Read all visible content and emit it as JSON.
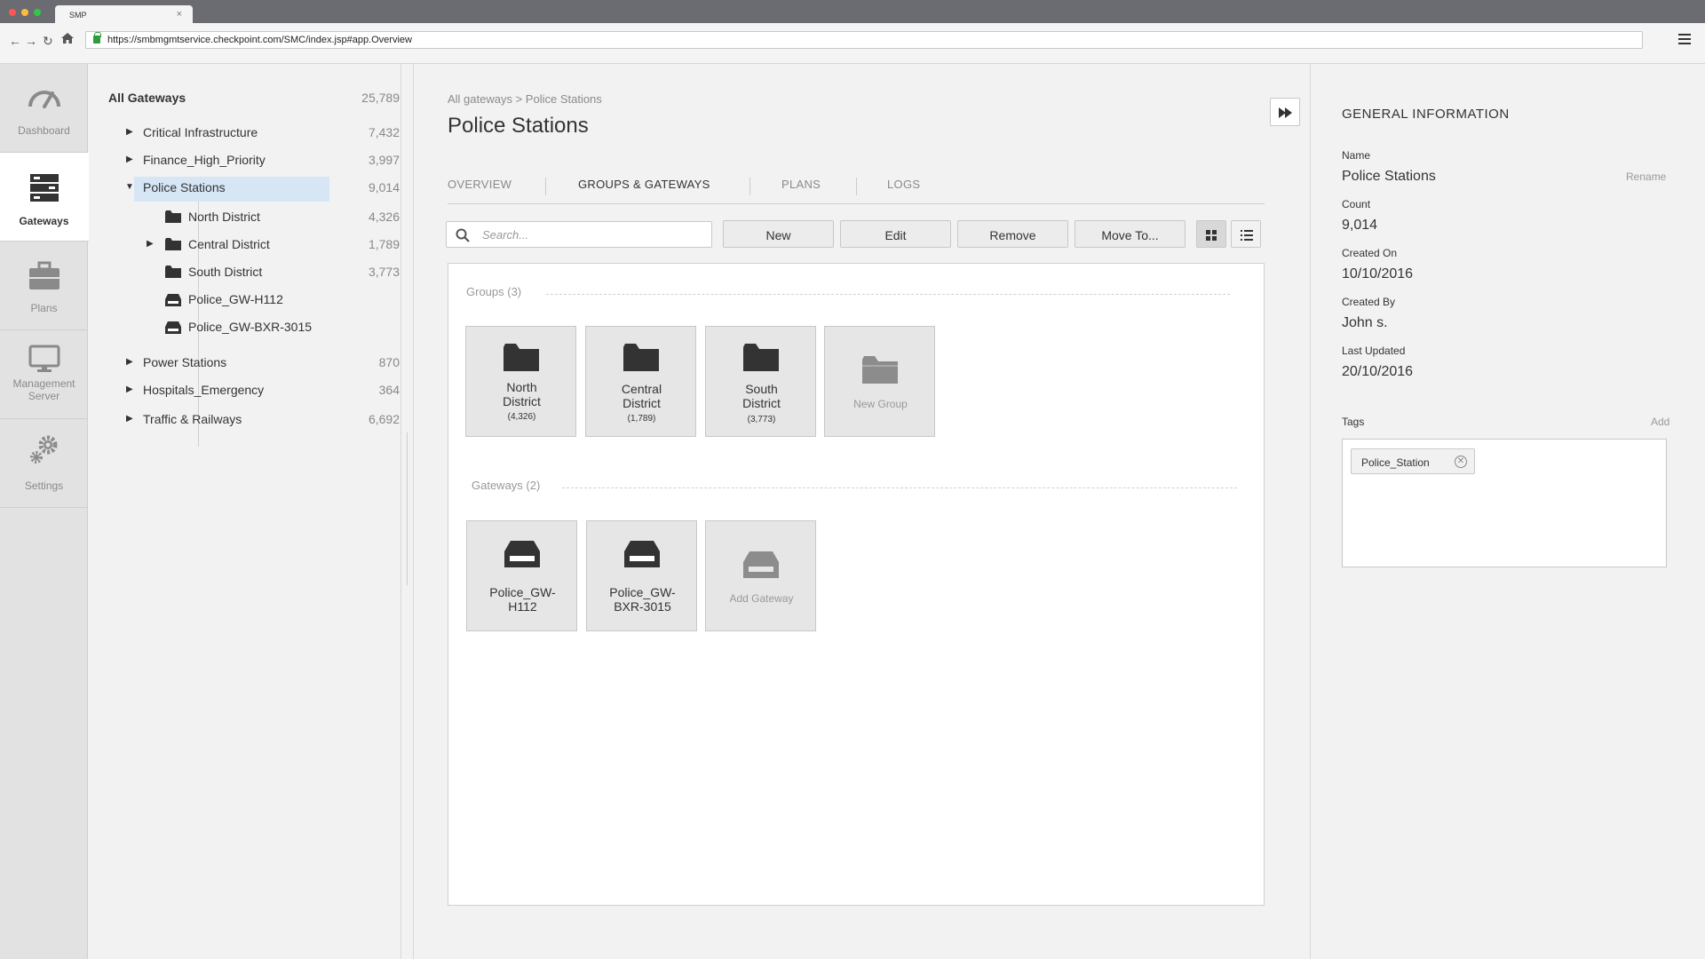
{
  "browser": {
    "tab_title": "SMP",
    "tab_close": "×",
    "url": "https://smbmgmtservice.checkpoint.com/SMC/index.jsp#app.Overview"
  },
  "rail": {
    "items": [
      {
        "label": "Dashboard",
        "icon": "gauge-icon"
      },
      {
        "label": "Gateways",
        "icon": "server-icon"
      },
      {
        "label": "Plans",
        "icon": "briefcase-icon"
      },
      {
        "label": "Management Server",
        "icon": "monitor-icon"
      },
      {
        "label": "Settings",
        "icon": "gears-icon"
      }
    ]
  },
  "tree": {
    "root": {
      "label": "All Gateways",
      "count": "25,789"
    },
    "items": [
      {
        "label": "Critical Infrastructure",
        "count": "7,432"
      },
      {
        "label": "Finance_High_Priority",
        "count": "3,997"
      },
      {
        "label": "Police Stations",
        "count": "9,014"
      },
      {
        "label": "North District",
        "count": "4,326"
      },
      {
        "label": "Central District",
        "count": "1,789"
      },
      {
        "label": "South District",
        "count": "3,773"
      },
      {
        "label": "Police_GW-H112",
        "count": ""
      },
      {
        "label": "Police_GW-BXR-3015",
        "count": ""
      },
      {
        "label": "Power Stations",
        "count": "870"
      },
      {
        "label": "Hospitals_Emergency",
        "count": "364"
      },
      {
        "label": "Traffic & Railways",
        "count": "6,692"
      }
    ]
  },
  "main": {
    "breadcrumb": "All gateways > Police Stations",
    "title": "Police Stations",
    "tabs": [
      "OVERVIEW",
      "GROUPS & GATEWAYS",
      "PLANS",
      "LOGS"
    ],
    "search_placeholder": "Search...",
    "buttons": {
      "new": "New",
      "edit": "Edit",
      "remove": "Remove",
      "move": "Move To..."
    },
    "groups_title": "Groups (3)",
    "groups": [
      {
        "line1": "North",
        "line2": "District",
        "count": "(4,326)"
      },
      {
        "line1": "Central",
        "line2": "District",
        "count": "(1,789)"
      },
      {
        "line1": "South",
        "line2": "District",
        "count": "(3,773)"
      }
    ],
    "new_group": "New Group",
    "gateways_title": "Gateways (2)",
    "gateways": [
      {
        "line1": "Police_GW-",
        "line2": "H112"
      },
      {
        "line1": "Police_GW-",
        "line2": "BXR-3015"
      }
    ],
    "add_gateway": "Add Gateway"
  },
  "info": {
    "title": "GENERAL INFORMATION",
    "name_label": "Name",
    "name_value": "Police Stations",
    "rename": "Rename",
    "count_label": "Count",
    "count_value": "9,014",
    "created_on_label": "Created On",
    "created_on_value": "10/10/2016",
    "created_by_label": "Created By",
    "created_by_value": "John s.",
    "updated_label": "Last Updated",
    "updated_value": "20/10/2016",
    "tags_label": "Tags",
    "tags_add": "Add",
    "tags": [
      "Police_Station"
    ]
  },
  "colors": {
    "selected_row": "#d6e6f5",
    "secure_lock": "#2e9b3c"
  }
}
